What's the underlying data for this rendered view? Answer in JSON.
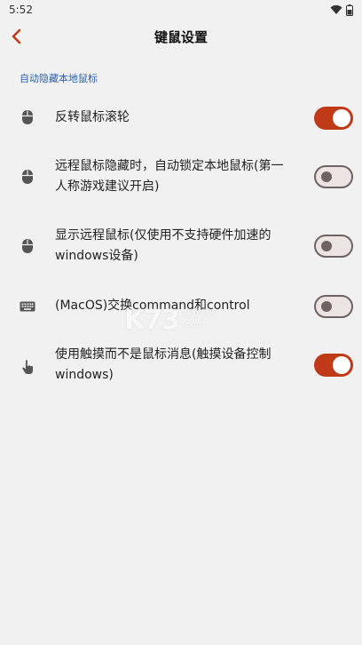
{
  "status_bar": {
    "time": "5:52"
  },
  "app_bar": {
    "title": "键鼠设置"
  },
  "section": {
    "header": "自动隐藏本地鼠标"
  },
  "settings": [
    {
      "icon": "mouse-icon",
      "label": "反转鼠标滚轮",
      "enabled": true
    },
    {
      "icon": "mouse-icon",
      "label": "远程鼠标隐藏时，自动锁定本地鼠标(第一人称游戏建议开启)",
      "enabled": false
    },
    {
      "icon": "mouse-icon",
      "label": "显示远程鼠标(仅使用不支持硬件加速的windows设备)",
      "enabled": false
    },
    {
      "icon": "keyboard-icon",
      "label": "(MacOS)交换command和control",
      "enabled": false
    },
    {
      "icon": "touch-icon",
      "label": "使用触摸而不是鼠标消息(触摸设备控制windows)",
      "enabled": true
    }
  ],
  "watermark": {
    "main": "K73",
    "line1": "游戏之家",
    "line2": ".com"
  },
  "colors": {
    "accent": "#bf3a16",
    "section_header": "#2b5ea7",
    "background": "#f1f1f1"
  }
}
